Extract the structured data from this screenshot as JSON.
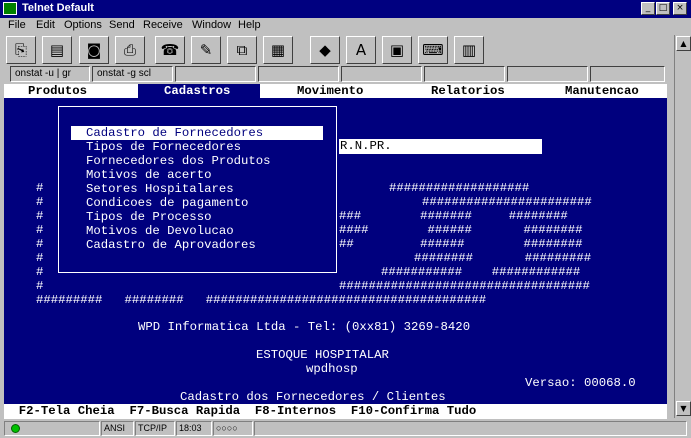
{
  "window": {
    "title": "Telnet Default",
    "min": "_",
    "max": "□",
    "close": "×"
  },
  "menubar": [
    "File",
    "Edit",
    "Options",
    "Send",
    "Receive",
    "Window",
    "Help"
  ],
  "toolbar_icons": [
    "copy-icon",
    "paste-icon",
    "camera-icon",
    "print-icon",
    "phone-icon",
    "disconnect-icon",
    "network-icon",
    "layout-icon",
    "car-icon",
    "font-icon",
    "computer-icon",
    "keyboard-icon",
    "keypad-icon"
  ],
  "sessions": [
    "onstat -u | gr",
    "onstat -g scl",
    "",
    "",
    "",
    "",
    "",
    ""
  ],
  "terminal": {
    "menu": [
      "Produtos",
      "Cadastros",
      "Movimento",
      "Relatorios",
      "Manutencao"
    ],
    "menu_selected": 1,
    "field_value": "R.N.PR.",
    "popup_items": [
      "Cadastro de Fornecedores",
      "Tipos de Fornecedores",
      "Fornecedores dos Produtos",
      "Motivos de acerto",
      "Setores Hospitalares",
      "Condicoes de pagamento",
      "Tipos de Processo",
      "Motivos de Devolucao",
      "Cadastro de Aprovadores"
    ],
    "popup_selected": 0,
    "company": "WPD Informatica Ltda - Tel: (0xx81) 3269-8420",
    "system_name": "ESTOQUE HOSPITALAR",
    "db_name": "wpdhosp",
    "version": "Versao: 00068.0",
    "screen_title": "Cadastro dos Fornecedores / Clientes",
    "fkeys": "  F2-Tela Cheia  F7-Busca Rapida  F8-Internos  F10-Confirma Tudo"
  },
  "statusbar": {
    "mode": "ANSI",
    "protocol": "TCP/IP",
    "time": "18:03",
    "indicator": "○○○○"
  }
}
